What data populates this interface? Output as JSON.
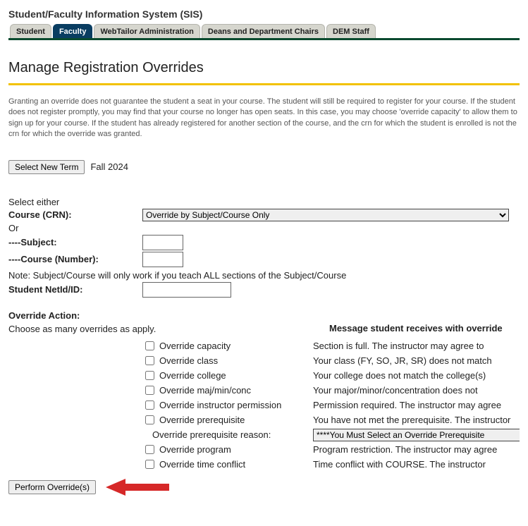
{
  "system_title": "Student/Faculty Information System (SIS)",
  "tabs": [
    "Student",
    "Faculty",
    "WebTailor Administration",
    "Deans and Department Chairs",
    "DEM Staff"
  ],
  "active_tab_index": 1,
  "page_title": "Manage Registration Overrides",
  "intro_text": "Granting an override does not guarantee the student a seat in your course. The student will still be required to register for your course. If the student does not register promptly, you may find that your course no longer has open seats. In this case, you may choose 'override capacity' to allow them to sign up for your course. If the student has already registered for another section of the course, and the crn for which the student is enrolled is not the crn for which the override was granted.",
  "buttons": {
    "select_new_term": "Select New Term",
    "perform_overrides": "Perform Override(s)"
  },
  "term_label": "Fall 2024",
  "labels": {
    "select_either": "Select either",
    "course_crn": "Course (CRN):",
    "or": "Or",
    "subject": "----Subject:",
    "course_number": "----Course (Number):",
    "note": "Note: Subject/Course will only work if you teach ALL sections of the Subject/Course",
    "student_netid": "Student NetId/ID:",
    "override_action": "Override Action:",
    "choose_many": "Choose as many overrides as apply.",
    "msg_heading": "Message student receives with override",
    "reason_label": "Override prerequisite reason:"
  },
  "crn_selected": "Override by Subject/Course Only",
  "overrides": [
    {
      "label": "Override capacity",
      "msg": "Section is full. The instructor may agree to"
    },
    {
      "label": "Override class",
      "msg": "Your class (FY, SO, JR, SR) does not match"
    },
    {
      "label": "Override college",
      "msg": "Your college does not match the college(s)"
    },
    {
      "label": "Override maj/min/conc",
      "msg": "Your major/minor/concentration does not"
    },
    {
      "label": "Override instructor permission",
      "msg": "Permission required. The instructor may agree"
    },
    {
      "label": "Override prerequisite",
      "msg": "You have not met the prerequisite. The instructor"
    }
  ],
  "reason_selected": "****You Must Select an Override Prerequisite",
  "overrides2": [
    {
      "label": "Override program",
      "msg": "Program restriction. The instructor may agree"
    },
    {
      "label": "Override time conflict",
      "msg": "Time conflict with COURSE. The instructor"
    }
  ]
}
